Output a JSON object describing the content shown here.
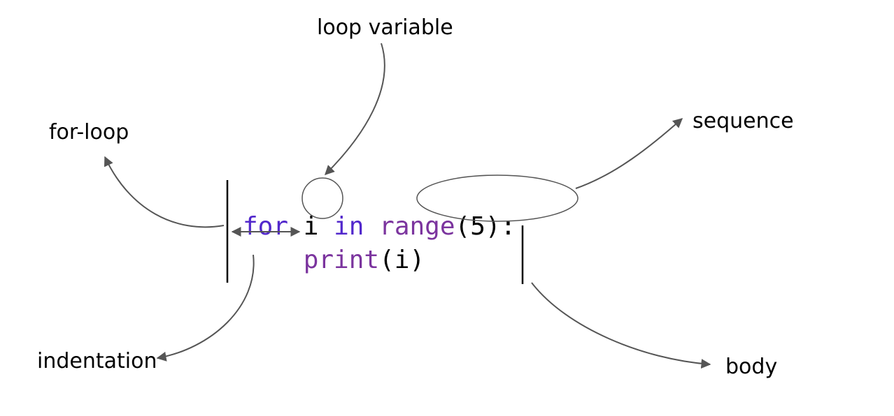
{
  "labels": {
    "loop_variable": "loop variable",
    "for_loop": "for-loop",
    "sequence": "sequence",
    "indentation": "indentation",
    "body": "body"
  },
  "code": {
    "for": "for",
    "space": " ",
    "i": "i",
    "in": "in",
    "range": "range",
    "lparen": "(",
    "five": "5",
    "rparen_colon": "):",
    "indent": "    ",
    "print": "print",
    "i2": "i",
    "rparen2": ")"
  },
  "colors": {
    "keyword": "#5228cc",
    "function": "#7b349e",
    "plain": "#000000",
    "arrow": "#555555"
  }
}
